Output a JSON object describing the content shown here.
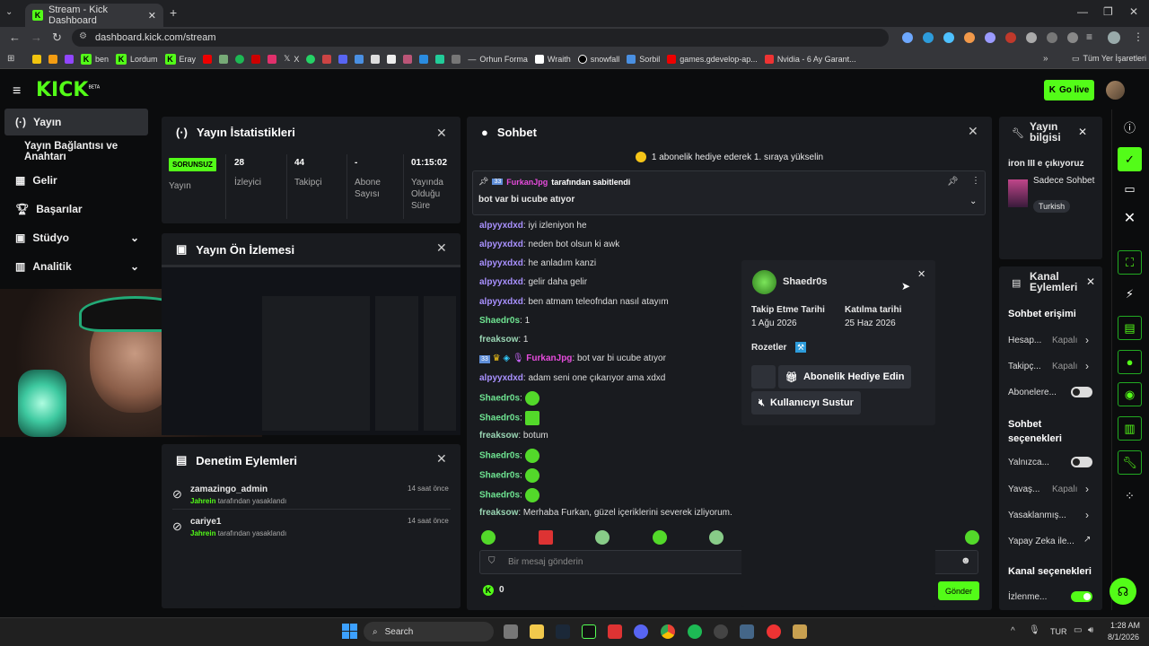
{
  "browser": {
    "tab_title": "Stream - Kick Dashboard",
    "url": "dashboard.kick.com/stream",
    "bookmarks": [
      "ben",
      "Lordum",
      "Eray",
      "X",
      "Orhun Forma",
      "Wraith",
      "snowfall",
      "Sorbil",
      "games.gdevelop-ap...",
      "Nvidia - 6 Ay Garant..."
    ],
    "all_bookmarks": "Tüm Yer İşaretleri"
  },
  "header": {
    "logo": "KICK",
    "beta": "BETA",
    "go_live": "Go live"
  },
  "sidebar": {
    "items": [
      {
        "label": "Yayın"
      },
      {
        "label": "Yayın Bağlantısı ve Anahtarı"
      },
      {
        "label": "Gelir"
      },
      {
        "label": "Başarılar"
      },
      {
        "label": "Stüdyo"
      },
      {
        "label": "Analitik"
      }
    ]
  },
  "stats": {
    "title": "Yayın İstatistikleri",
    "status_badge": "SORUNSUZ",
    "status_label": "Yayın",
    "viewers": "28",
    "viewers_label": "İzleyici",
    "followers": "44",
    "followers_label": "Takipçi",
    "subs": "-",
    "subs_label": "Abone Sayısı",
    "uptime": "01:15:02",
    "uptime_label": "Yayında Olduğu Süre"
  },
  "preview": {
    "title": "Yayın Ön İzlemesi"
  },
  "moderation": {
    "title": "Denetim Eylemleri",
    "entries": [
      {
        "user": "zamazingo_admin",
        "by": "Jahrein",
        "action": "tarafından yasaklandı",
        "time": "14 saat önce"
      },
      {
        "user": "cariye1",
        "by": "Jahrein",
        "action": "tarafından yasaklandı",
        "time": "14 saat önce"
      }
    ]
  },
  "chat": {
    "title": "Sohbet",
    "gift_banner": "1 abonelik hediye ederek 1. sıraya yükselin",
    "pinned_by": "FurkanJpg",
    "pinned_suffix": "tarafından sabitlendi",
    "pinned_msg": "bot var bi ucube atıyor",
    "messages": [
      {
        "user": "alpyyxdxd",
        "text": "iyi izleniyon he"
      },
      {
        "user": "alpyyxdxd",
        "text": "neden bot olsun ki awk"
      },
      {
        "user": "alpyyxdxd",
        "text": "he anladım kanzi"
      },
      {
        "user": "alpyyxdxd",
        "text": "gelir daha gelir"
      },
      {
        "user": "alpyyxdxd",
        "text": "ben atmam teleofndan nasıl atayım"
      },
      {
        "user": "Shaedr0s",
        "text": "1"
      },
      {
        "user": "freaksow",
        "text": "1"
      },
      {
        "user": "FurkanJpg",
        "text": "bot var bi ucube atıyor"
      },
      {
        "user": "alpyyxdxd",
        "text": "adam seni one çıkarıyor ama xdxd"
      },
      {
        "user": "Shaedr0s",
        "text": ""
      },
      {
        "user": "Shaedr0s",
        "text": ""
      },
      {
        "user": "freaksow",
        "text": "botum"
      },
      {
        "user": "Shaedr0s",
        "text": ""
      },
      {
        "user": "Shaedr0s",
        "text": ""
      },
      {
        "user": "Shaedr0s",
        "text": ""
      },
      {
        "user": "freaksow",
        "text": "Merhaba Furkan, güzel içeriklerini severek izliyorum."
      }
    ],
    "badge_num": "33",
    "input_placeholder": "Bir mesaj gönderin",
    "points": "0",
    "send": "Gönder"
  },
  "user_card": {
    "username": "Shaedr0s",
    "follow_label": "Takip Etme Tarihi",
    "follow_date": "1 Ağu 2026",
    "join_label": "Katılma tarihi",
    "join_date": "25 Haz 2026",
    "badges_label": "Rozetler",
    "gift_btn": "Abonelik Hediye Edin",
    "mute_btn": "Kullanıcıyı Sustur"
  },
  "stream_info": {
    "title": "Yayın bilgisi",
    "stream_title": "iron III e çıkıyoruz",
    "category": "Sadece Sohbet",
    "language": "Turkish"
  },
  "channel_actions": {
    "title": "Kanal Eylemleri",
    "chat_access": "Sohbet erişimi",
    "rows1": [
      {
        "label": "Hesap...",
        "value": "Kapalı"
      },
      {
        "label": "Takipç...",
        "value": "Kapalı"
      },
      {
        "label": "Abonelere...",
        "value": ""
      }
    ],
    "chat_options": "Sohbet seçenekleri",
    "rows2": [
      {
        "label": "Yalnızca...",
        "value": ""
      },
      {
        "label": "Yavaş...",
        "value": "Kapalı"
      },
      {
        "label": "Yasaklanmış...",
        "value": ""
      },
      {
        "label": "Yapay Zeka ile...",
        "value": ""
      }
    ],
    "channel_options": "Kanal seçenekleri",
    "row3": "İzlenme..."
  },
  "taskbar": {
    "search": "Search",
    "lang": "TUR",
    "time": "1:28 AM",
    "date": "8/1/2026"
  }
}
